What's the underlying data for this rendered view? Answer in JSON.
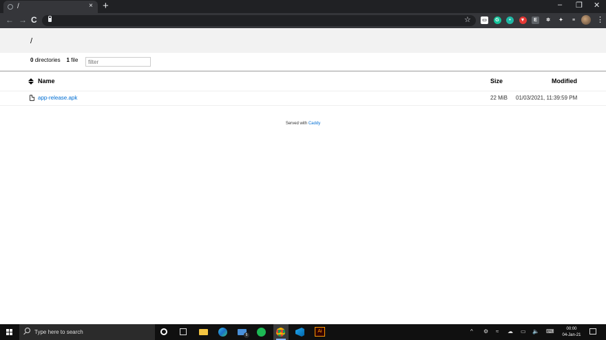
{
  "browser": {
    "tab_title": "/",
    "tab_close": "×",
    "new_tab": "+",
    "window_controls": [
      "–",
      "❐",
      "✕"
    ],
    "nav": [
      "←",
      "→",
      "C"
    ],
    "star": "☆",
    "menu": "⋮",
    "extensions": [
      {
        "name": "ext-icon-1",
        "color": "#ffffff",
        "label": "▭"
      },
      {
        "name": "ext-icon-2",
        "color": "#15c39a",
        "label": "G"
      },
      {
        "name": "ext-icon-3",
        "color": "#1fb8a5",
        "label": "•"
      },
      {
        "name": "ext-icon-4",
        "color": "#e53935",
        "label": "▼"
      },
      {
        "name": "ext-icon-5",
        "color": "#5f6368",
        "label": "E"
      },
      {
        "name": "ext-icon-6",
        "color": "#35363a",
        "label": "✲"
      },
      {
        "name": "ext-icon-7",
        "color": "#35363a",
        "label": "✦"
      },
      {
        "name": "ext-icon-8",
        "color": "#35363a",
        "label": "≡"
      }
    ]
  },
  "page": {
    "breadcrumb": "/",
    "dir_count": "0",
    "dir_label": "directories",
    "file_count": "1",
    "file_label": "file",
    "filter_placeholder": "filter",
    "columns": {
      "name": "Name",
      "size": "Size",
      "modified": "Modified"
    },
    "files": [
      {
        "name": "app-release.apk",
        "size": "22 MiB",
        "modified": "01/03/2021, 11:39:59 PM"
      }
    ],
    "footer_text": "Served with",
    "footer_link": "Caddy"
  },
  "taskbar": {
    "search_placeholder": "Type here to search",
    "time": "00:00",
    "date": "04-Jan-21",
    "mail_badge": "5",
    "illustrator_label": "Ai",
    "tray": [
      "^",
      "⚙",
      "≈",
      "☁",
      "▭",
      "🔈",
      "⌨"
    ]
  }
}
